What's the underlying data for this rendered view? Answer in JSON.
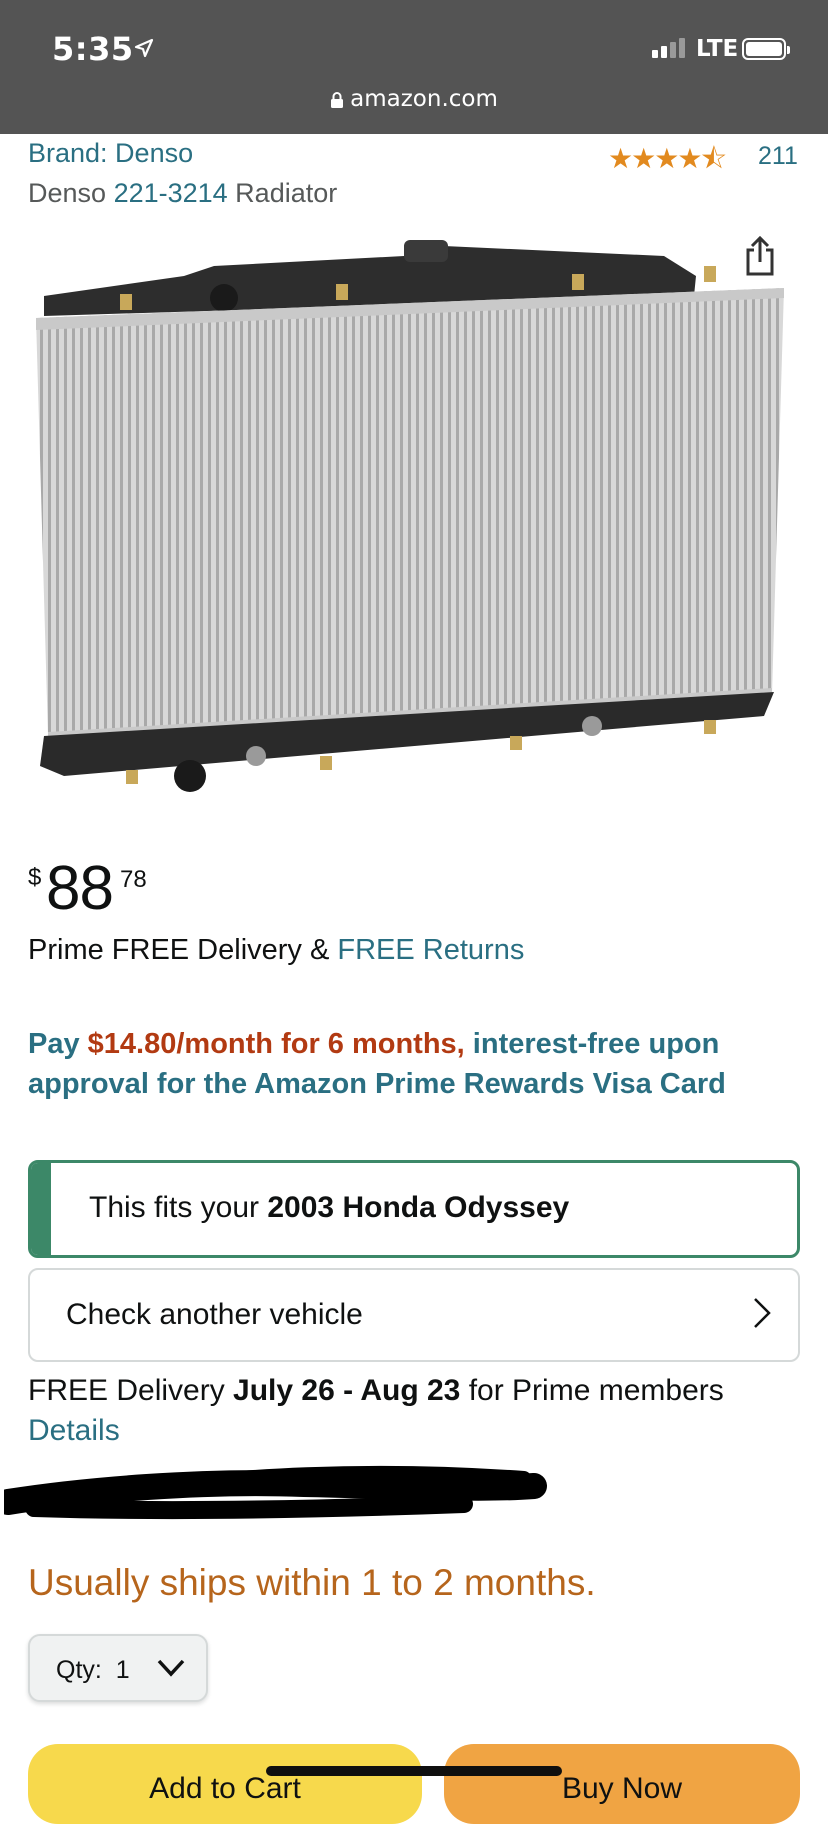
{
  "status": {
    "time": "5:35",
    "network": "LTE",
    "url": "amazon.com"
  },
  "product": {
    "brand": "Brand: Denso",
    "rating_count": "211",
    "title_prefix": "Denso ",
    "title_link": "221-3214",
    "title_suffix": " Radiator",
    "stars": 4.5
  },
  "price": {
    "currency": "$",
    "whole": "88",
    "fraction": "78"
  },
  "delivery": {
    "prime_text": "Prime FREE Delivery & ",
    "returns_link": "FREE Returns",
    "dates_prefix": "FREE Delivery ",
    "dates": "July 26 - Aug 23",
    "dates_suffix": " for Prime members",
    "details_link": "Details"
  },
  "payment": {
    "pay": "Pay ",
    "amount": "$14.80/month for 6 months,",
    "rest": " interest-free upon approval for the Amazon Prime Rewards Visa Card"
  },
  "fit": {
    "prefix": "This fits your ",
    "vehicle": "2003 Honda Odyssey"
  },
  "check_vehicle": "Check another vehicle",
  "availability": "Usually ships within 1 to 2 months.",
  "quantity": {
    "label": "Qty:",
    "value": "1"
  },
  "buttons": {
    "add_to_cart": "Add to Cart",
    "buy_now": "Buy Now"
  },
  "colors": {
    "link": "#2a6f82",
    "fit_green": "#3c8868",
    "cart_yellow": "#f7d94c",
    "buy_orange": "#f0a443"
  }
}
